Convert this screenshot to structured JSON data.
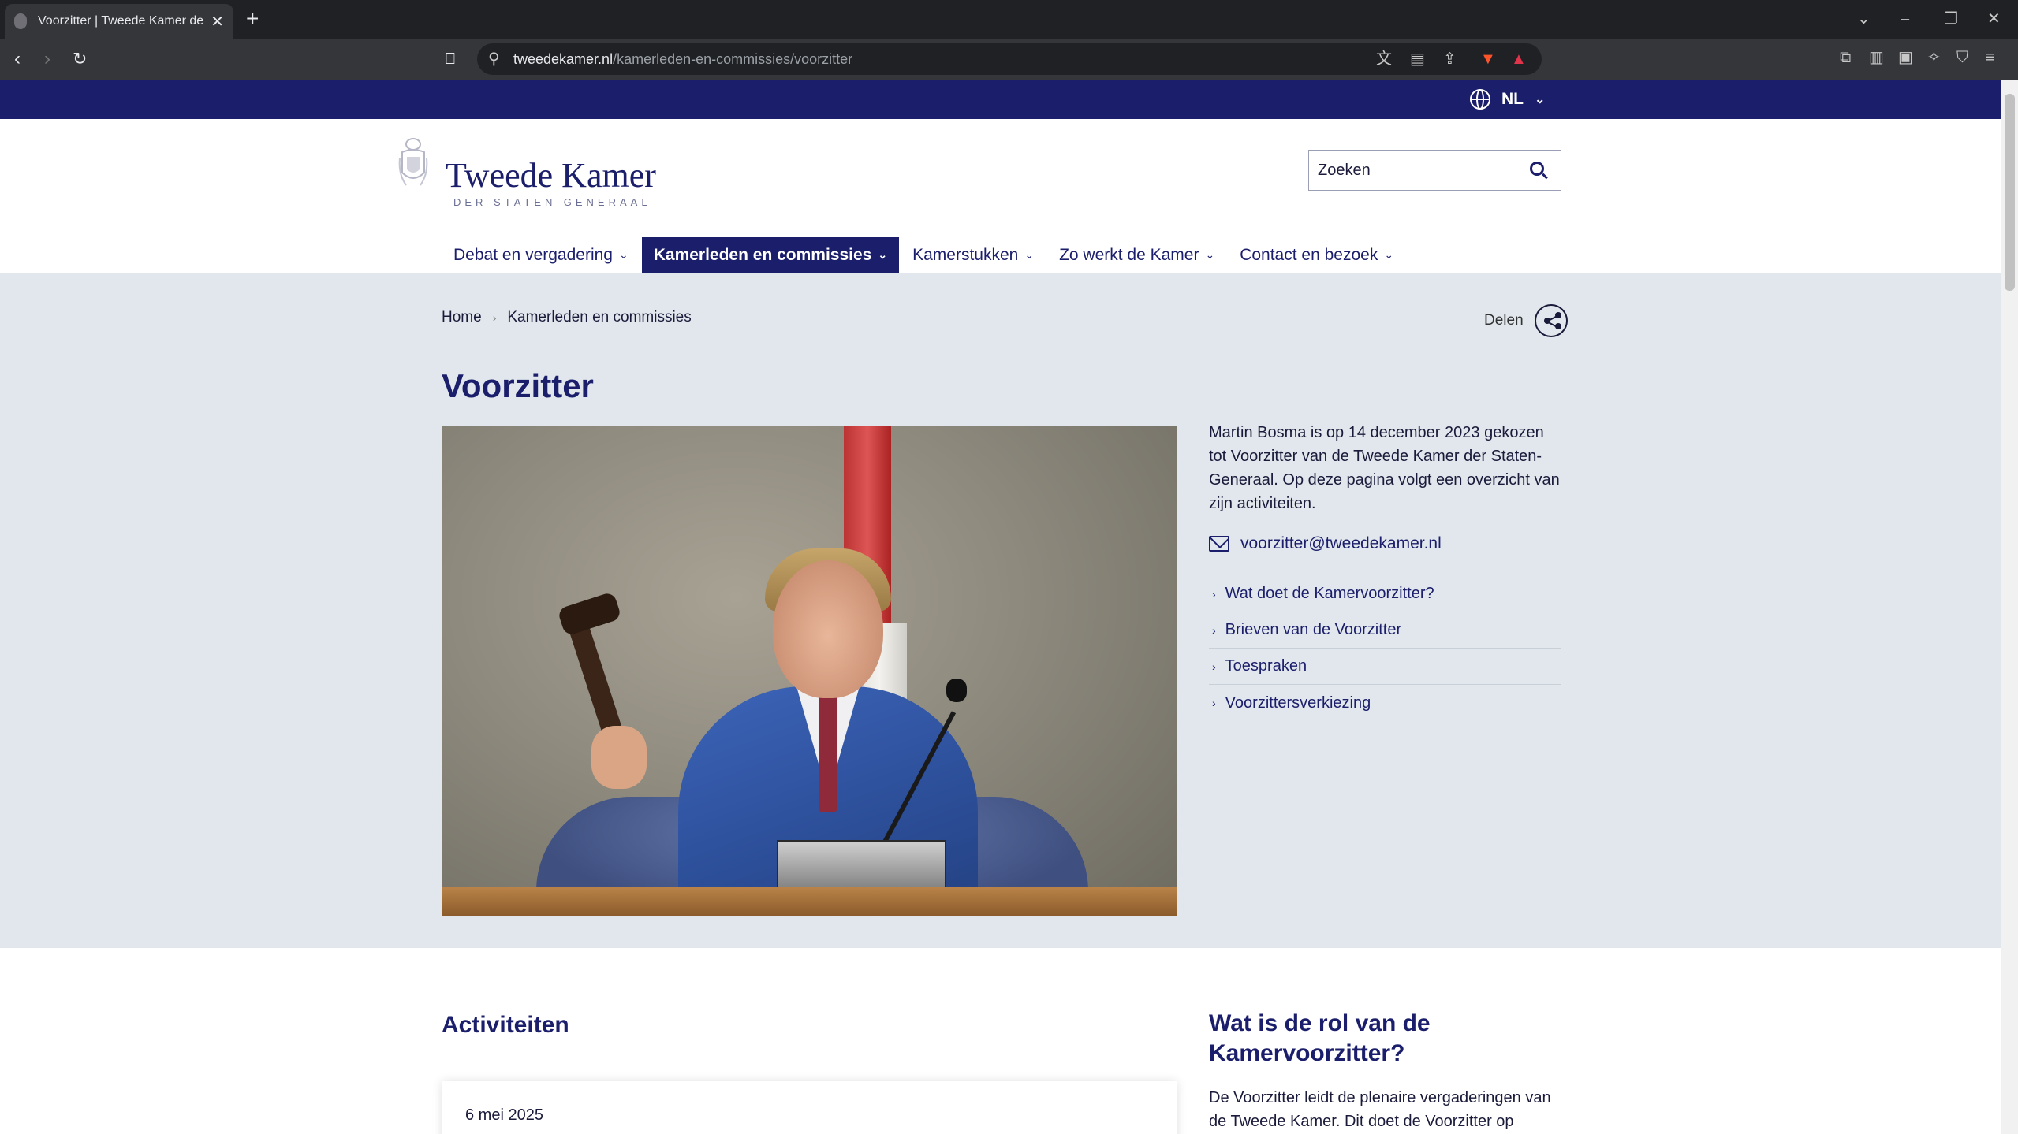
{
  "browser": {
    "tab_title": "Voorzitter | Tweede Kamer der S",
    "new_tab": "+",
    "tab_close": "✕",
    "url_domain": "tweedekamer.nl",
    "url_path": "/kamerleden-en-commissies/voorzitter",
    "win_minimize": "–",
    "win_restore": "❐",
    "win_close": "✕",
    "win_tabsearch": "⌄"
  },
  "topbar": {
    "language": "NL",
    "bg_color": "#1b1e6b"
  },
  "logo": {
    "title": "Tweede Kamer",
    "subtitle": "DER STATEN-GENERAAL"
  },
  "search": {
    "placeholder": "Zoeken"
  },
  "nav": {
    "items": [
      {
        "label": "Debat en vergadering"
      },
      {
        "label": "Kamerleden en commissies"
      },
      {
        "label": "Kamerstukken"
      },
      {
        "label": "Zo werkt de Kamer"
      },
      {
        "label": "Contact en bezoek"
      }
    ],
    "active_index": 1
  },
  "breadcrumb": {
    "home": "Home",
    "current": "Kamerleden en commissies"
  },
  "share": {
    "label": "Delen"
  },
  "page": {
    "title": "Voorzitter",
    "intro": "Martin Bosma is op 14 december 2023 gekozen tot Voorzitter van de Tweede Kamer der Staten-Generaal. Op deze pagina volgt een overzicht van zijn activiteiten.",
    "email": "voorzitter@tweedekamer.nl",
    "links": [
      {
        "label": "Wat doet de Kamervoorzitter?"
      },
      {
        "label": "Brieven van de Voorzitter"
      },
      {
        "label": "Toespraken"
      },
      {
        "label": "Voorzittersverkiezing"
      }
    ]
  },
  "activities": {
    "title": "Activiteiten",
    "first_date": "6 mei 2025"
  },
  "role": {
    "title": "Wat is de rol van de Kamervoorzitter?",
    "text": "De Voorzitter leidt de plenaire vergaderingen van de Tweede Kamer. Dit doet de Voorzitter op"
  },
  "colors": {
    "brand_navy": "#1b1e6b",
    "hero_bg": "#e1e7ec"
  }
}
